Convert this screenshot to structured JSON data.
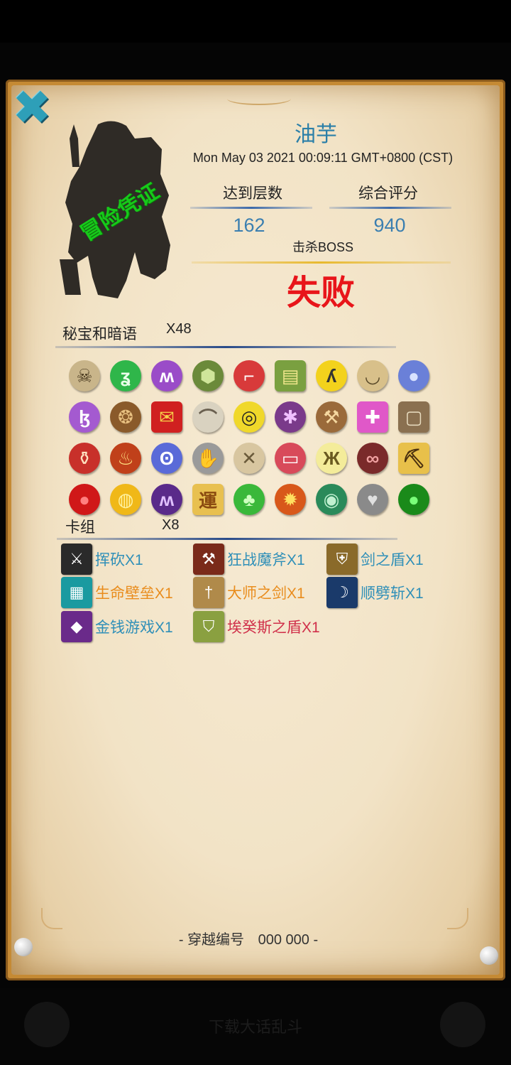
{
  "colors": {
    "name": "#2b7fa8",
    "result": "#e8151a",
    "stamp": "#17c91a",
    "card_blue": "#2f8fb8",
    "card_orange": "#e98c1c",
    "card_red": "#d0304a"
  },
  "header": {
    "close_icon": "close-x-icon",
    "stamp_text": "冒险凭证",
    "player_name": "油芋",
    "timestamp": "Mon May 03 2021 00:09:11 GMT+0800 (CST)"
  },
  "stats": {
    "floor_label": "达到层数",
    "floor_value": "162",
    "score_label": "综合评分",
    "score_value": "940",
    "boss_label": "击杀BOSS",
    "result": "失败"
  },
  "treasures": {
    "title": "秘宝和暗语",
    "count": "X48",
    "items": [
      {
        "icon": "skull-icon",
        "glyph": "☠",
        "bg": "#c9b58a",
        "fg": "#4a3a20"
      },
      {
        "icon": "green-rune-icon",
        "glyph": "ʓ",
        "bg": "#2fb64a",
        "fg": "#eaffea"
      },
      {
        "icon": "purple-rune-icon",
        "glyph": "ʍ",
        "bg": "#9a4cc8",
        "fg": "#ffffff"
      },
      {
        "icon": "turtle-shell-icon",
        "glyph": "⬢",
        "bg": "#6b8a3a",
        "fg": "#cfe59a"
      },
      {
        "icon": "stocking-icon",
        "glyph": "⌐",
        "bg": "#d83a3a",
        "fg": "#ffffff"
      },
      {
        "icon": "spellbook-icon",
        "glyph": "▤",
        "bg": "#7aa040",
        "fg": "#f0e68c",
        "square": true
      },
      {
        "icon": "yellow-rune-icon",
        "glyph": "ʎ",
        "bg": "#f3d21c",
        "fg": "#333333"
      },
      {
        "icon": "bowl-icon",
        "glyph": "◡",
        "bg": "#d8c08a",
        "fg": "#5a4a2a"
      },
      {
        "icon": "crystal-orb-icon",
        "glyph": "●",
        "bg": "#6a80d8",
        "fg": "#d8e2ff"
      },
      {
        "icon": "violet-rune-icon",
        "glyph": "ɮ",
        "bg": "#a45ad0",
        "fg": "#ffffff"
      },
      {
        "icon": "loot-bag-icon",
        "glyph": "❂",
        "bg": "#8a5a2a",
        "fg": "#e8c080"
      },
      {
        "icon": "red-envelope-icon",
        "glyph": "✉",
        "bg": "#d02020",
        "fg": "#f7d04a",
        "square": true
      },
      {
        "icon": "bat-wing-icon",
        "glyph": "⌒",
        "bg": "#d9d2c0",
        "fg": "#6a6050"
      },
      {
        "icon": "swirl-token-icon",
        "glyph": "◎",
        "bg": "#f0d82a",
        "fg": "#222222"
      },
      {
        "icon": "candy-icon",
        "glyph": "✱",
        "bg": "#7a3a8a",
        "fg": "#f0c0ff"
      },
      {
        "icon": "shovel-icon",
        "glyph": "⚒",
        "bg": "#9a6a3a",
        "fg": "#f5d8a0"
      },
      {
        "icon": "gift-box-icon",
        "glyph": "✚",
        "bg": "#e058c8",
        "fg": "#ffffff",
        "square": true
      },
      {
        "icon": "picture-frame-icon",
        "glyph": "▢",
        "bg": "#8a7050",
        "fg": "#e8dcc0",
        "square": true
      },
      {
        "icon": "wine-glass-icon",
        "glyph": "⚱",
        "bg": "#c8302a",
        "fg": "#ffe0c0"
      },
      {
        "icon": "fire-seed-icon",
        "glyph": "♨",
        "bg": "#c0401a",
        "fg": "#ffe080"
      },
      {
        "icon": "blue-rune-icon",
        "glyph": "ʘ",
        "bg": "#5a6ad8",
        "fg": "#ffffff"
      },
      {
        "icon": "gauntlet-icon",
        "glyph": "✋",
        "bg": "#9a9a9a",
        "fg": "#ffffff"
      },
      {
        "icon": "bandage-icon",
        "glyph": "✕",
        "bg": "#d8c6a0",
        "fg": "#6a5a3a"
      },
      {
        "icon": "canister-icon",
        "glyph": "▭",
        "bg": "#d84a5a",
        "fg": "#ffffff"
      },
      {
        "icon": "butterfly-icon",
        "glyph": "Ж",
        "bg": "#f4ec9a",
        "fg": "#6a5a20"
      },
      {
        "icon": "chain-icon",
        "glyph": "∞",
        "bg": "#7a2a2a",
        "fg": "#f0a0a0"
      },
      {
        "icon": "pickaxe-card-icon",
        "glyph": "⛏",
        "bg": "#e8c04a",
        "fg": "#4a3010",
        "square": true
      },
      {
        "icon": "apple-icon",
        "glyph": "●",
        "bg": "#d01818",
        "fg": "#ff8080"
      },
      {
        "icon": "gold-coin-icon",
        "glyph": "◍",
        "bg": "#f0b818",
        "fg": "#fff2a0"
      },
      {
        "icon": "dark-rune-icon",
        "glyph": "ʍ",
        "bg": "#5a2a8a",
        "fg": "#e0c0ff"
      },
      {
        "icon": "scroll-card-icon",
        "glyph": "運",
        "bg": "#e8c050",
        "fg": "#8a4a10",
        "square": true
      },
      {
        "icon": "clover-icon",
        "glyph": "♣",
        "bg": "#3ab83a",
        "fg": "#cfffc0"
      },
      {
        "icon": "flame-shield-icon",
        "glyph": "✹",
        "bg": "#d8581a",
        "fg": "#ffe060"
      },
      {
        "icon": "jade-scroll-icon",
        "glyph": "◉",
        "bg": "#2a8a5a",
        "fg": "#c0f0d0"
      },
      {
        "icon": "stone-heart-icon",
        "glyph": "♥",
        "bg": "#8a8a8a",
        "fg": "#e0e0e0"
      },
      {
        "icon": "green-orb-icon",
        "glyph": "●",
        "bg": "#1a8a1a",
        "fg": "#7aff7a"
      }
    ]
  },
  "deck": {
    "title": "卡组",
    "count": "X8",
    "cards": [
      {
        "label": "挥砍X1",
        "icon": "cleave-card-icon",
        "glyph": "⚔",
        "bg": "#2a2a2a",
        "color": "#2f8fb8"
      },
      {
        "label": "狂战魔斧X1",
        "icon": "berserk-axe-card-icon",
        "glyph": "⚒",
        "bg": "#7a2a1a",
        "color": "#2f8fb8"
      },
      {
        "label": "剑之盾X1",
        "icon": "sword-shield-card-icon",
        "glyph": "⛨",
        "bg": "#8a6a2a",
        "color": "#2f8fb8"
      },
      {
        "label": "生命壁垒X1",
        "icon": "life-barrier-card-icon",
        "glyph": "▦",
        "bg": "#1a9aa0",
        "color": "#e98c1c"
      },
      {
        "label": "大师之剑X1",
        "icon": "master-sword-card-icon",
        "glyph": "†",
        "bg": "#b08a4a",
        "color": "#e98c1c"
      },
      {
        "label": "顺劈斩X1",
        "icon": "sweep-slash-card-icon",
        "glyph": "☽",
        "bg": "#1a3a6a",
        "color": "#2f8fb8"
      },
      {
        "label": "金钱游戏X1",
        "icon": "money-game-card-icon",
        "glyph": "◆",
        "bg": "#6a2a8a",
        "color": "#2f8fb8"
      },
      {
        "label": "埃癸斯之盾X1",
        "icon": "aegis-shield-card-icon",
        "glyph": "⛉",
        "bg": "#8aa040",
        "color": "#d0304a"
      }
    ]
  },
  "footer": {
    "serial_label": "穿越编号",
    "serial_value": "000 000",
    "hidden_text": "下载大话乱斗"
  }
}
